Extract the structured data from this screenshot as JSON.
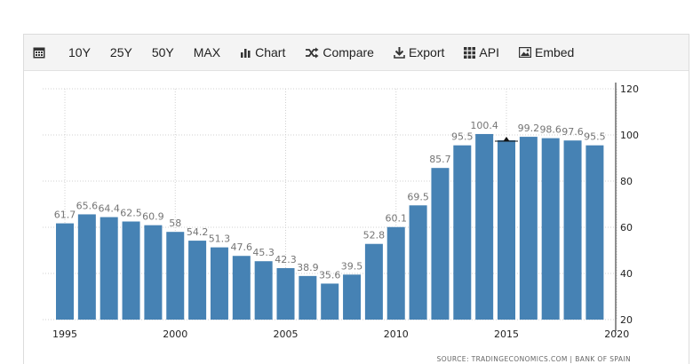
{
  "toolbar": {
    "calendar_icon": "calendar-icon",
    "items": [
      {
        "label": "10Y"
      },
      {
        "label": "25Y"
      },
      {
        "label": "50Y"
      },
      {
        "label": "MAX"
      },
      {
        "label": "Chart",
        "icon": "bar-chart-icon"
      },
      {
        "label": "Compare",
        "icon": "shuffle-icon"
      },
      {
        "label": "Export",
        "icon": "download-icon"
      },
      {
        "label": "API",
        "icon": "grid-icon"
      },
      {
        "label": "Embed",
        "icon": "image-icon"
      }
    ]
  },
  "source": "SOURCE: TRADINGECONOMICS.COM  |  BANK OF SPAIN",
  "colors": {
    "bar": "#4682b4",
    "grid": "#d0d0d0",
    "label": "#757575"
  },
  "chart_data": {
    "type": "bar",
    "title": "",
    "xlabel": "",
    "ylabel": "",
    "x": [
      1995,
      1996,
      1997,
      1998,
      1999,
      2000,
      2001,
      2002,
      2003,
      2004,
      2005,
      2006,
      2007,
      2008,
      2009,
      2010,
      2011,
      2012,
      2013,
      2014,
      2015,
      2016,
      2017,
      2018,
      2019
    ],
    "values": [
      61.7,
      65.6,
      64.4,
      62.5,
      60.9,
      58,
      54.2,
      51.3,
      47.6,
      45.3,
      42.3,
      38.9,
      35.6,
      39.5,
      52.8,
      60.1,
      69.5,
      85.7,
      95.5,
      100.4,
      97.7,
      99.2,
      98.6,
      97.6,
      95.5
    ],
    "data_labels": [
      "61.7",
      "65.6",
      "64.4",
      "62.5",
      "60.9",
      "58",
      "54.2",
      "51.3",
      "47.6",
      "45.3",
      "42.3",
      "38.9",
      "35.6",
      "39.5",
      "52.8",
      "60.1",
      "69.5",
      "85.7",
      "95.5",
      "100.4",
      "",
      "99.2",
      "98.6",
      "97.6",
      "95.5"
    ],
    "ylim": [
      20,
      120
    ],
    "yticks": [
      20,
      40,
      60,
      80,
      100,
      120
    ],
    "xticks": [
      1995,
      2000,
      2005,
      2010,
      2015,
      2020
    ],
    "y_axis_side": "right",
    "grid": true,
    "marker_year": 2015
  }
}
